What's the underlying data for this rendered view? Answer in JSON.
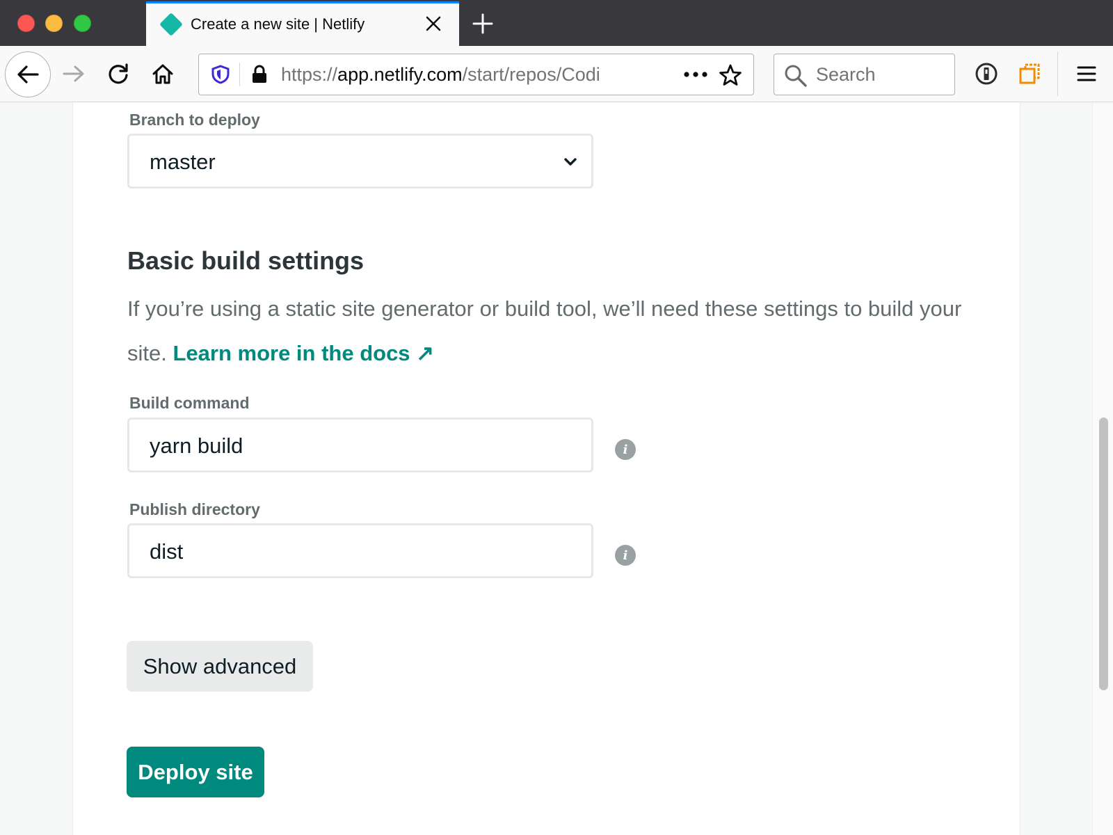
{
  "browser": {
    "tab": {
      "title": "Create a new site | Netlify",
      "favicon": "netlify-diamond-icon",
      "favicon_color": "#15b7a6"
    },
    "new_tab": "plus-icon",
    "nav": {
      "back": "back-arrow-icon",
      "forward": "forward-arrow-icon",
      "reload": "reload-icon",
      "home": "home-icon"
    },
    "url": {
      "scheme": "https://",
      "host": "app.netlify.com",
      "path": "/start/repos/Codi"
    },
    "search": {
      "placeholder": "Search"
    },
    "toolbar_icons": [
      "password-manager-icon",
      "extension-icon",
      "hamburger-menu-icon"
    ]
  },
  "form": {
    "branch": {
      "label": "Branch to deploy",
      "value": "master"
    },
    "build_settings": {
      "title": "Basic build settings",
      "description": "If you’re using a static site generator or build tool, we’ll need these settings to build your site. ",
      "docs_link": "Learn more in the docs ↗"
    },
    "build_command": {
      "label": "Build command",
      "value": "yarn build",
      "info": "i"
    },
    "publish_directory": {
      "label": "Publish directory",
      "value": "dist",
      "info": "i"
    },
    "show_advanced": "Show advanced",
    "deploy": "Deploy site"
  },
  "colors": {
    "accent": "#00897d",
    "firefox_blue": "#0a84ff"
  }
}
